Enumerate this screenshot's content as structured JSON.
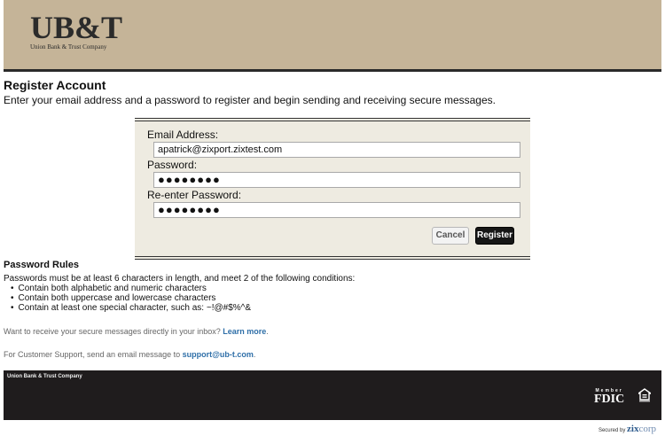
{
  "header": {
    "logo_mark": "UB&T",
    "logo_sub": "Union Bank & Trust Company"
  },
  "page": {
    "title": "Register Account",
    "subtitle": "Enter your email address and a password to register and begin sending and receiving secure messages."
  },
  "form": {
    "email_label": "Email Address:",
    "email_value": "apatrick@zixport.zixtest.com",
    "password_label": "Password:",
    "password_value": "●●●●●●●●",
    "reenter_label": "Re-enter Password:",
    "reenter_value": "●●●●●●●●",
    "cancel_label": "Cancel",
    "register_label": "Register"
  },
  "rules": {
    "title": "Password Rules",
    "intro": "Passwords must be at least 6 characters in length, and meet 2 of the following conditions:",
    "items": [
      "Contain both alphabetic and numeric characters",
      "Contain both uppercase and lowercase characters",
      "Contain at least one special character, such as: ~!@#$%^&"
    ]
  },
  "notes": {
    "inbox_text": "Want to receive your secure messages directly in your inbox? ",
    "inbox_link": "Learn more",
    "inbox_end": ".",
    "support_text": "For Customer Support, send an email message to ",
    "support_link": "support@ub-t.com",
    "support_end": "."
  },
  "footer": {
    "bank_name": "Union Bank & Trust Company",
    "fdic_top": "Member",
    "fdic_main": "FDIC",
    "equal_housing_icon": "equal-housing-icon"
  },
  "secured": {
    "prefix": "Secured by",
    "brand_zix": "zix",
    "brand_corp": "corp"
  },
  "colors": {
    "header_bg": "#c5b498",
    "form_bg": "#eeebe1",
    "footer_bg": "#1f1c1d",
    "link": "#2f6fa8"
  }
}
